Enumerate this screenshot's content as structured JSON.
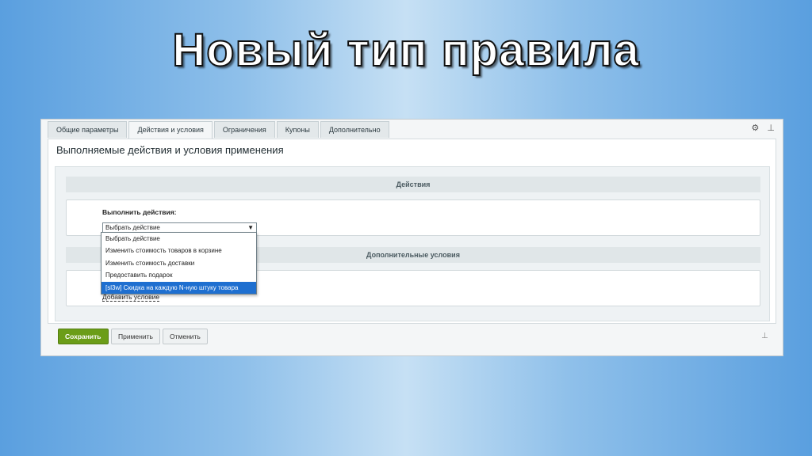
{
  "slide_title": "Новый тип правила",
  "tabs": [
    "Общие параметры",
    "Действия и условия",
    "Ограничения",
    "Купоны",
    "Дополнительно"
  ],
  "active_tab_index": 1,
  "section_heading": "Выполняемые действия и условия применения",
  "actions_bar": "Действия",
  "actions_label": "Выполнить действия:",
  "actions_select_value": "Выбрать действие",
  "dropdown_options": [
    "Выбрать действие",
    "Изменить стоимость товаров в корзине",
    "Изменить стоимость доставки",
    "Предоставить подарок",
    "[sl3w] Скидка на каждую N-ную штуку товара"
  ],
  "dropdown_highlighted_index": 4,
  "conditions_bar": "Дополнительные условия",
  "add_condition": "Добавить условие",
  "buttons": {
    "save": "Сохранить",
    "apply": "Применить",
    "cancel": "Отменить"
  },
  "colors": {
    "accent_green": "#6b9d18",
    "selected_blue": "#1e6fd0"
  }
}
